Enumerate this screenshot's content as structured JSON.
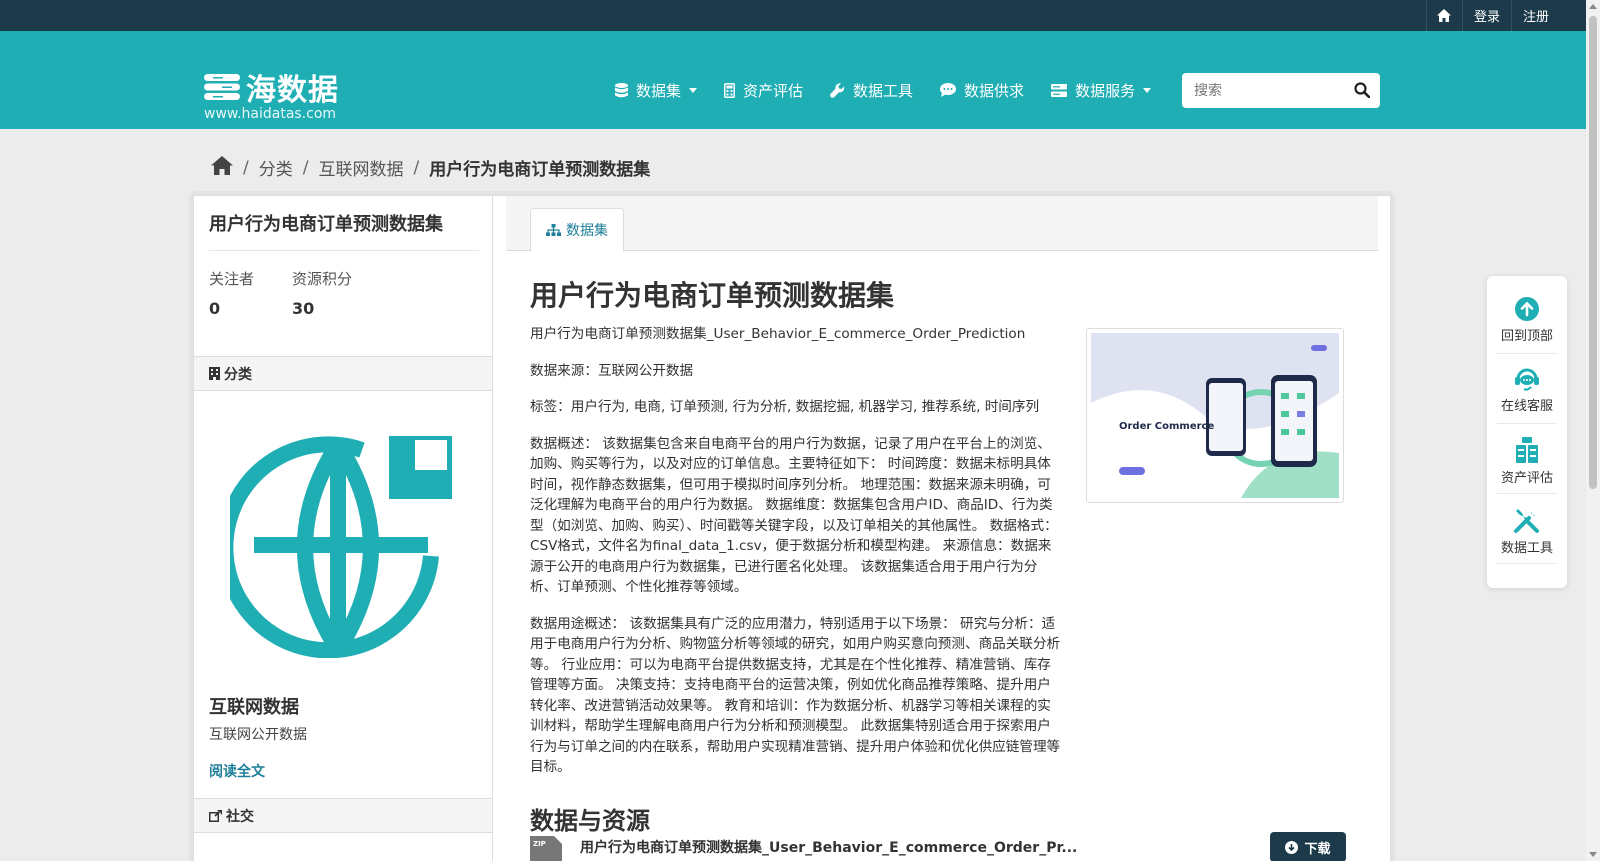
{
  "topbar": {
    "login": "登录",
    "register": "注册",
    "home_icon": "home-icon"
  },
  "brand": {
    "name": "海数据",
    "url": "www.haidatas.com"
  },
  "nav": [
    {
      "label": "数据集",
      "icon": "database-icon",
      "dropdown": true
    },
    {
      "label": "资产评估",
      "icon": "calculator-icon",
      "dropdown": false
    },
    {
      "label": "数据工具",
      "icon": "wrench-icon",
      "dropdown": false
    },
    {
      "label": "数据供求",
      "icon": "chat-icon",
      "dropdown": false
    },
    {
      "label": "数据服务",
      "icon": "server-icon",
      "dropdown": true
    }
  ],
  "search": {
    "placeholder": "搜索",
    "value": ""
  },
  "breadcrumb": {
    "category": "分类",
    "parent": "互联网数据",
    "current": "用户行为电商订单预测数据集"
  },
  "sidebar": {
    "title": "用户行为电商订单预测数据集",
    "followers_label": "关注者",
    "followers_value": "0",
    "points_label": "资源积分",
    "points_value": "30",
    "category_heading": "分类",
    "category_name": "互联网数据",
    "category_desc": "互联网公开数据",
    "read_more": "阅读全文",
    "social_heading": "社交"
  },
  "tab": {
    "label": "数据集"
  },
  "dataset": {
    "title": "用户行为电商订单预测数据集",
    "paragraphs": [
      "用户行为电商订单预测数据集_User_Behavior_E_commerce_Order_Prediction",
      "数据来源：互联网公开数据",
      "标签：用户行为, 电商, 订单预测, 行为分析, 数据挖掘, 机器学习, 推荐系统, 时间序列",
      "数据概述： 该数据集包含来自电商平台的用户行为数据，记录了用户在平台上的浏览、加购、购买等行为，以及对应的订单信息。主要特征如下： 时间跨度：数据未标明具体时间，视作静态数据集，但可用于模拟时间序列分析。 地理范围：数据来源未明确，可泛化理解为电商平台的用户行为数据。 数据维度：数据集包含用户ID、商品ID、行为类型（如浏览、加购、购买）、时间戳等关键字段，以及订单相关的其他属性。 数据格式：CSV格式，文件名为final_data_1.csv，便于数据分析和模型构建。 来源信息：数据来源于公开的电商用户行为数据集，已进行匿名化处理。 该数据集适合用于用户行为分析、订单预测、个性化推荐等领域。",
      "数据用途概述： 该数据集具有广泛的应用潜力，特别适用于以下场景： 研究与分析：适用于电商用户行为分析、购物篮分析等领域的研究，如用户购买意向预测、商品关联分析等。 行业应用：可以为电商平台提供数据支持，尤其是在个性化推荐、精准营销、库存管理等方面。 决策支持：支持电商平台的运营决策，例如优化商品推荐策略、提升用户转化率、改进营销活动效果等。 教育和培训：作为数据分析、机器学习等相关课程的实训材料，帮助学生理解电商用户行为分析和预测模型。 此数据集特别适合用于探索用户行为与订单之间的内在联系，帮助用户实现精准营销、提升用户体验和优化供应链管理等目标。"
    ],
    "thumbnail_text": "Order Commerce",
    "resources_heading": "数据与资源",
    "resource_name": "用户行为电商订单预测数据集_User_Behavior_E_commerce_Order_Pr...",
    "resource_badge": "ZIP",
    "download_label": "下载"
  },
  "floatbar": [
    {
      "label": "回到顶部",
      "icon": "arrow-up-circle-icon"
    },
    {
      "label": "在线客服",
      "icon": "headset-icon"
    },
    {
      "label": "资产评估",
      "icon": "assets-icon"
    },
    {
      "label": "数据工具",
      "icon": "tools-icon"
    }
  ],
  "colors": {
    "topbar": "#1c3a4a",
    "brand": "#20aeb5",
    "link": "#1f7f9a",
    "button": "#1c3a4a"
  }
}
